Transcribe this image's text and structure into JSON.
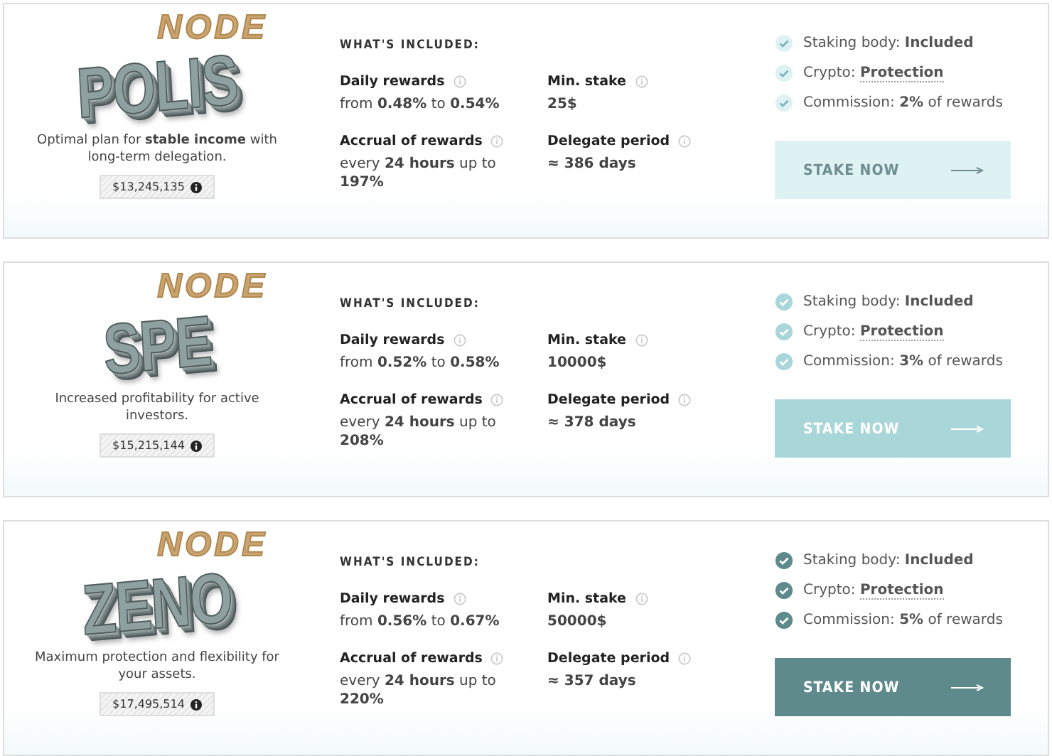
{
  "plans": [
    {
      "name": "POLIS",
      "bg_word": "NODE",
      "description": "Optimal plan for **stable income** with long-term delegation.",
      "tvl": "$13,245,135",
      "included_title": "WHAT'S INCLUDED:",
      "color": "#def2f4",
      "stats": [
        {
          "label": "Daily rewards",
          "value": "from **0.48%** to **0.54%**"
        },
        {
          "label": "Min. stake",
          "value": "**25$**"
        },
        {
          "label": "Accrual of rewards",
          "value": "every **24 hours** up to **197%**"
        },
        {
          "label": "Delegate period",
          "value": "**≈ 386 days**"
        }
      ],
      "features": [
        "Staking body: **Included**",
        "Crypto: **Protection**",
        "Commission: **2%** of rewards"
      ],
      "button": "STAKE NOW"
    },
    {
      "name": "SPE",
      "bg_word": "NODE",
      "description": "Increased profitability for active investors.",
      "tvl": "$15,215,144",
      "included_title": "WHAT'S INCLUDED:",
      "color": "#a8d6d9",
      "stats": [
        {
          "label": "Daily rewards",
          "value": "from **0.52%** to **0.58%**"
        },
        {
          "label": "Min. stake",
          "value": "**10000$**"
        },
        {
          "label": "Accrual of rewards",
          "value": "every **24 hours** up to **208%**"
        },
        {
          "label": "Delegate period",
          "value": "**≈ 378 days**"
        }
      ],
      "features": [
        "Staking body: **Included**",
        "Crypto: **Protection**",
        "Commission: **3%** of rewards"
      ],
      "button": "STAKE NOW"
    },
    {
      "name": "ZENO",
      "bg_word": "NODE",
      "description": "Maximum protection and flexibility for your assets.",
      "tvl": "$17,495,514",
      "included_title": "WHAT'S INCLUDED:",
      "color": "#5f8a8b",
      "stats": [
        {
          "label": "Daily rewards",
          "value": "from **0.56%** to **0.67%**"
        },
        {
          "label": "Min. stake",
          "value": "**50000$**"
        },
        {
          "label": "Accrual of rewards",
          "value": "every **24 hours** up to **220%**"
        },
        {
          "label": "Delegate period",
          "value": "**≈ 357 days**"
        }
      ],
      "features": [
        "Staking body: **Included**",
        "Crypto: **Protection**",
        "Commission: **5%** of rewards"
      ],
      "button": "STAKE NOW"
    }
  ]
}
